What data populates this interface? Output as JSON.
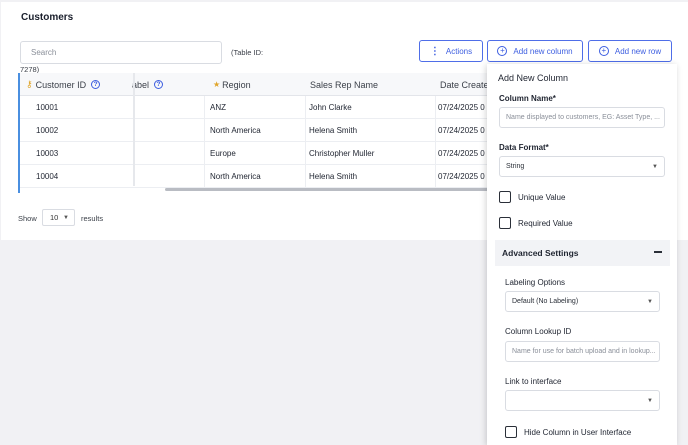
{
  "page": {
    "title": "Customers"
  },
  "toolbar": {
    "search_placeholder": "Search",
    "table_id_prefix": "(Table ID:",
    "table_id_suffix": "7278)",
    "actions_label": "Actions",
    "add_column_label": "Add new column",
    "add_row_label": "Add new row"
  },
  "table": {
    "columns": [
      "Customer ID",
      "abel",
      "Region",
      "Sales Rep Name",
      "Date Create"
    ],
    "rows": [
      {
        "id": "10001",
        "label": "",
        "region": "ANZ",
        "rep": "John Clarke",
        "date": "07/24/2025 0"
      },
      {
        "id": "10002",
        "label": "",
        "region": "North America",
        "rep": "Helena Smith",
        "date": "07/24/2025 0"
      },
      {
        "id": "10003",
        "label": "",
        "region": "Europe",
        "rep": "Christopher Muller",
        "date": "07/24/2025 0"
      },
      {
        "id": "10004",
        "label": "",
        "region": "North America",
        "rep": "Helena Smith",
        "date": "07/24/2025 0"
      }
    ]
  },
  "pagination": {
    "show_label": "Show",
    "page_size": "10",
    "results_label": "results"
  },
  "panel": {
    "title": "Add New Column",
    "column_name_label": "Column Name*",
    "column_name_placeholder": "Name displayed to customers, EG: Asset Type, ...",
    "data_format_label": "Data Format*",
    "data_format_value": "String",
    "unique_label": "Unique Value",
    "required_label": "Required Value",
    "advanced_label": "Advanced Settings",
    "labeling_label": "Labeling Options",
    "labeling_value": "Default (No Labeling)",
    "lookup_label": "Column Lookup ID",
    "lookup_placeholder": "Name for use for batch upload and in lookup...",
    "link_label": "Link to interface",
    "link_value": "",
    "hide_label": "Hide Column in User Interface"
  },
  "colors": {
    "accent": "#3d5ee0",
    "frozen_bar": "#4a8fe0",
    "key": "#e0a52a"
  }
}
